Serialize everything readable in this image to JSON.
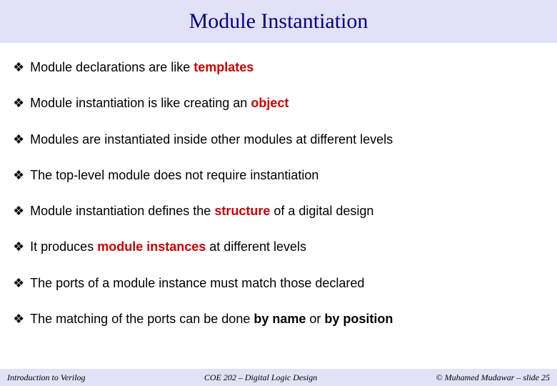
{
  "title": "Module Instantiation",
  "bullets": {
    "b0": {
      "pre": "Module declarations are like ",
      "bold": "templates",
      "post": ""
    },
    "b1": {
      "pre": "Module instantiation is like creating an ",
      "bold": "object",
      "post": ""
    },
    "b2": {
      "text": "Modules are instantiated inside other modules at different levels"
    },
    "b3": {
      "text": "The top-level module does not require instantiation"
    },
    "b4": {
      "pre": "Module instantiation defines the ",
      "bold": "structure",
      "post": " of a digital design"
    },
    "b5": {
      "pre": "It produces ",
      "bold": "module instances",
      "post": " at different levels"
    },
    "b6": {
      "text": "The ports of a module instance must match those declared"
    },
    "b7": {
      "pre": "The matching of the ports can be done ",
      "b1": "by name",
      "mid": " or ",
      "b2": "by position"
    }
  },
  "footer": {
    "left": "Introduction to Verilog",
    "center": "COE 202 – Digital Logic Design",
    "right": "© Muhamed Mudawar – slide 25"
  }
}
